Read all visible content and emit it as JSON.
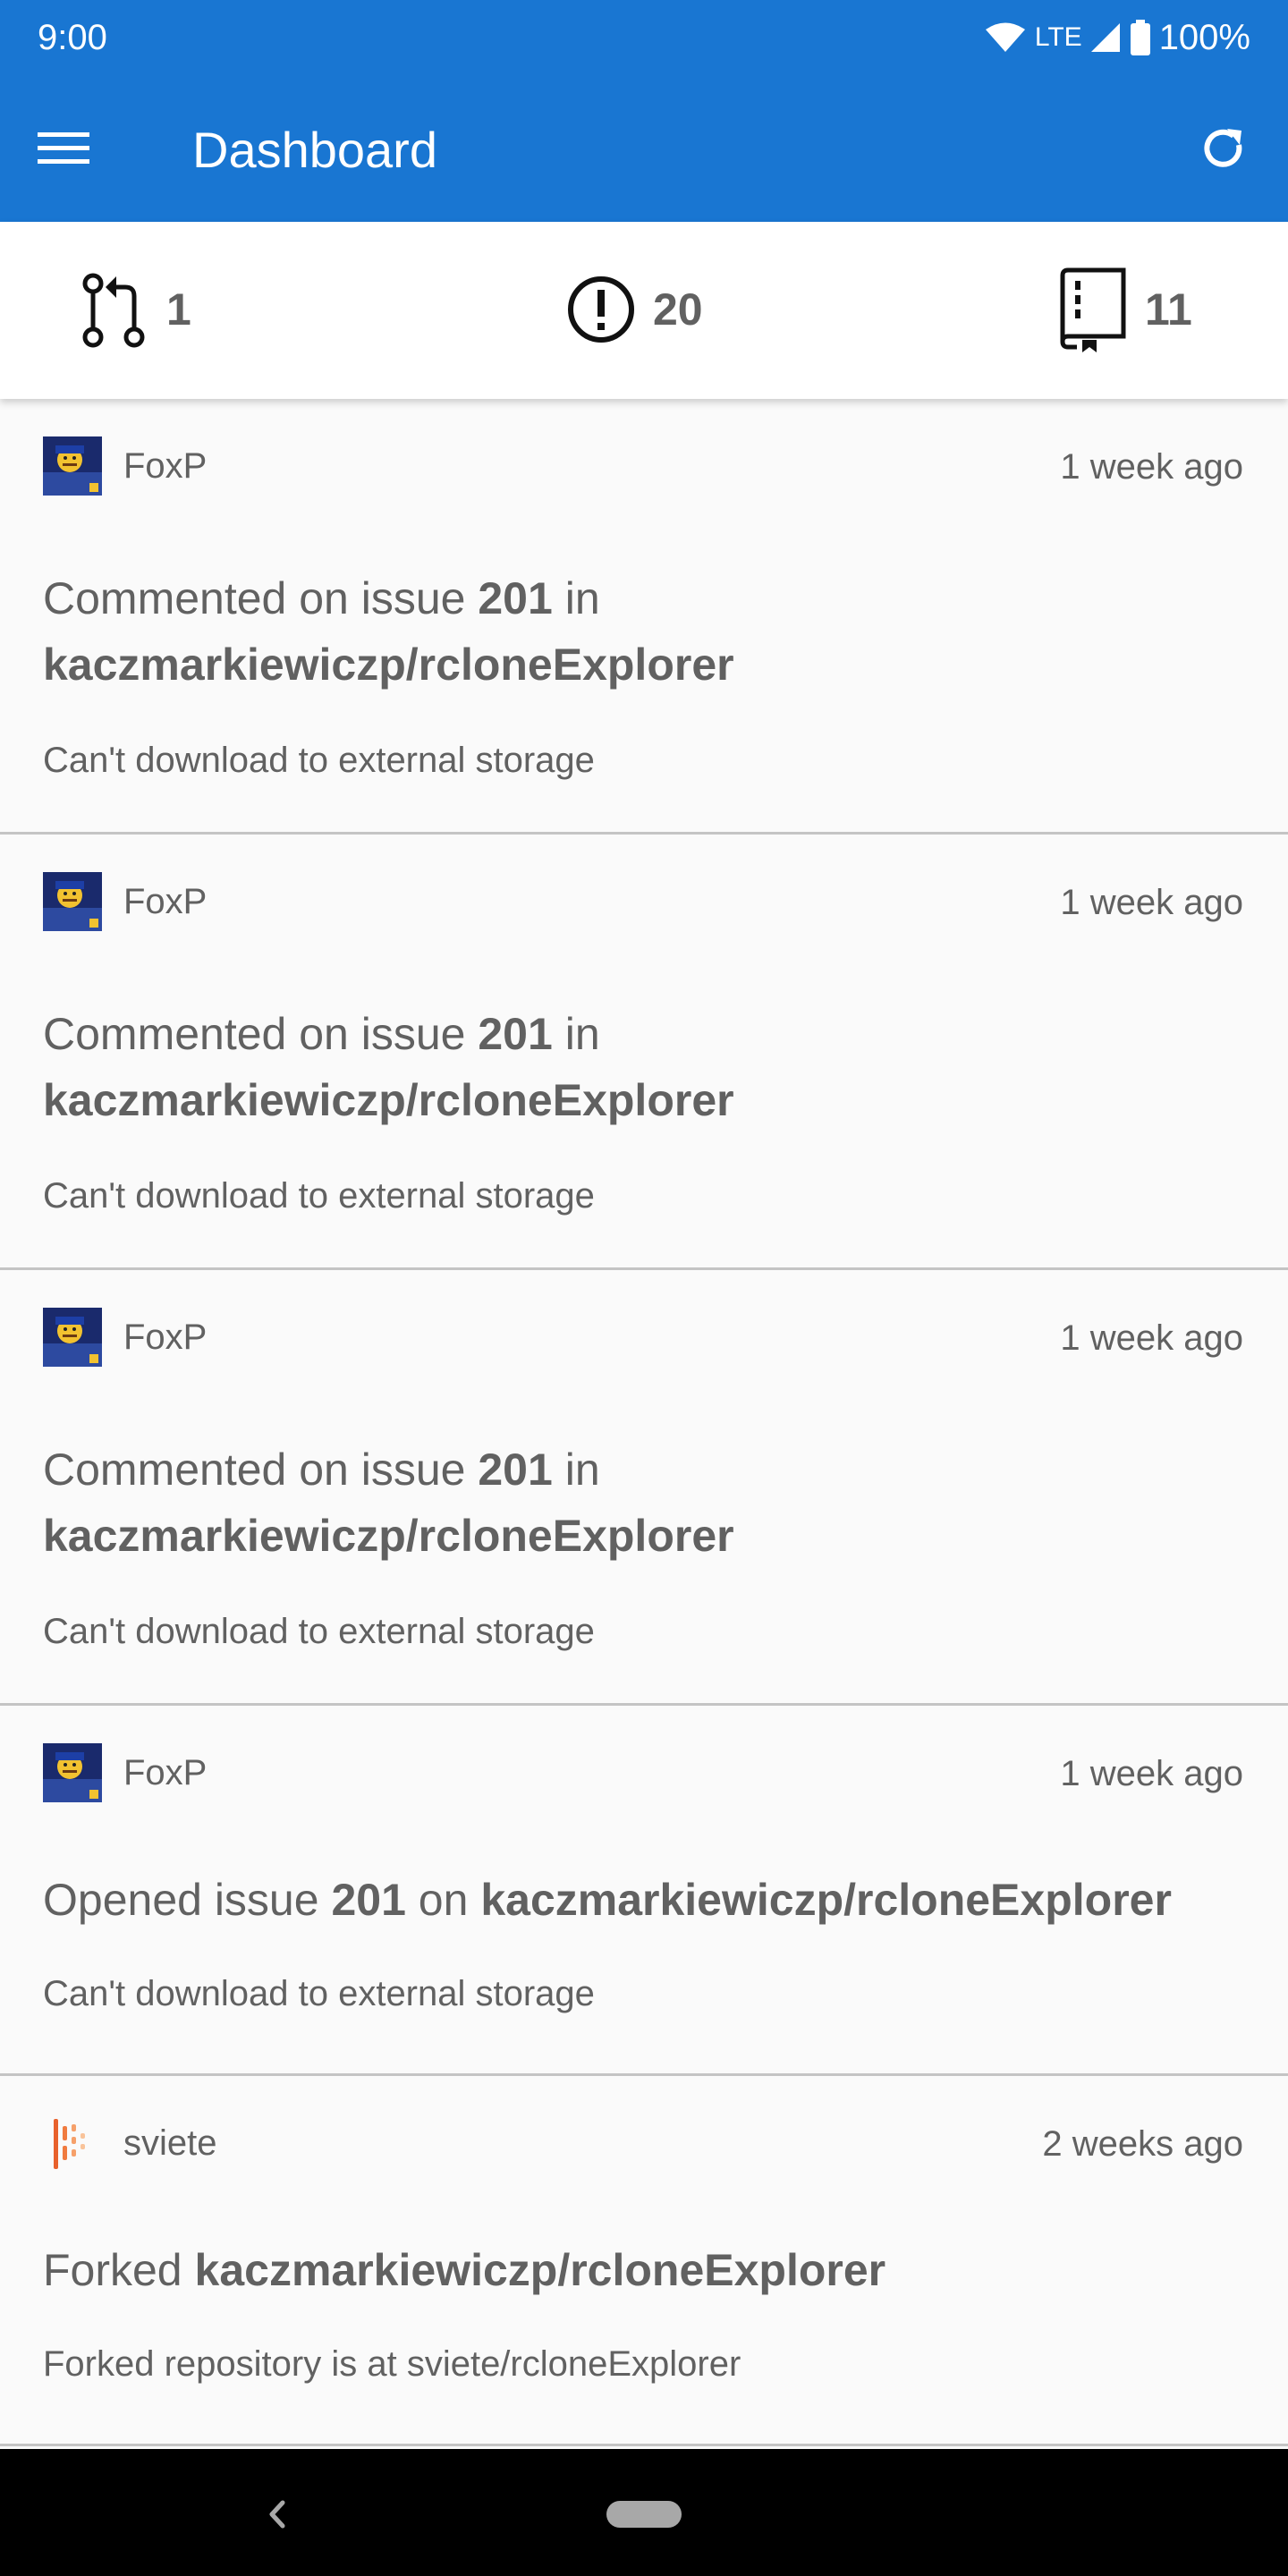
{
  "status_bar": {
    "time": "9:00",
    "network": "LTE",
    "battery": "100%"
  },
  "toolbar": {
    "title": "Dashboard",
    "menu_icon": "hamburger-menu-icon",
    "refresh_icon": "refresh-icon",
    "color": "#1976d2"
  },
  "stats": {
    "pull_requests": "1",
    "issues": "20",
    "repositories": "11"
  },
  "feed": [
    {
      "user": "FoxP",
      "time": "1 week ago",
      "verb": "Commented on issue",
      "number": "201",
      "connector": "in",
      "repo": "kaczmarkiewiczp/rcloneExplorer",
      "description": "Can't download to external storage"
    },
    {
      "user": "FoxP",
      "time": "1 week ago",
      "verb": "Commented on issue",
      "number": "201",
      "connector": "in",
      "repo": "kaczmarkiewiczp/rcloneExplorer",
      "description": "Can't download to external storage"
    },
    {
      "user": "FoxP",
      "time": "1 week ago",
      "verb": "Commented on issue",
      "number": "201",
      "connector": "in",
      "repo": "kaczmarkiewiczp/rcloneExplorer",
      "description": "Can't download to external storage"
    },
    {
      "user": "FoxP",
      "time": "1 week ago",
      "verb": "Opened issue",
      "number": "201",
      "connector": "on",
      "repo": "kaczmarkiewiczp/rcloneExplorer",
      "description": "Can't download to external storage"
    },
    {
      "user": "sviete",
      "time": "2 weeks ago",
      "verb": "Forked",
      "repo": "kaczmarkiewiczp/rcloneExplorer",
      "description": "Forked repository is at sviete/rcloneExplorer"
    }
  ]
}
